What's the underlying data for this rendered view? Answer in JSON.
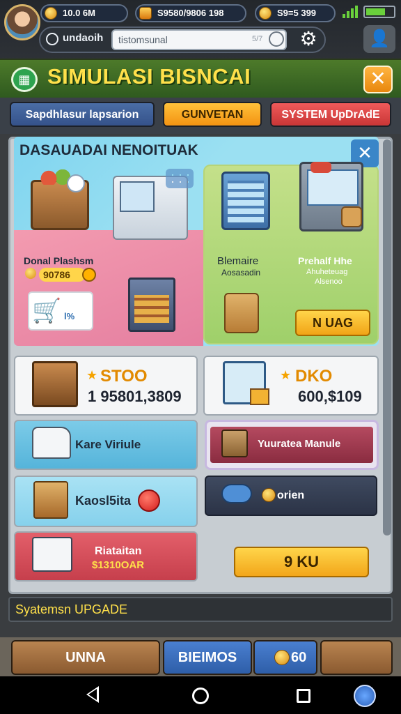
{
  "status_bar": {
    "resource1": "10.0 6M",
    "resource2": "S9580/9806 198",
    "resource3": "S9=5 399"
  },
  "browser": {
    "label": "undaoih",
    "input_value": "tistomsunal",
    "count": "5/7"
  },
  "header": {
    "title": "SIMULASI BISNCAI"
  },
  "tabs": [
    {
      "label": "Sapdhlasur lapsarion"
    },
    {
      "label": "GUNVETAN"
    },
    {
      "label": "SYSTEM UpDrAdE"
    }
  ],
  "featured": {
    "title": "DASAUADAI NENOITUAK",
    "promo_label": "Donal Plashsm",
    "promo_value": "90786",
    "cart_tag": "l%",
    "store1_name": "Blemaire",
    "store1_sub": "Aosasadin",
    "store2_name": "Prehalf Hhe",
    "store2_sub": "Ahuheteuag",
    "store2_sub2": "Alsenoo",
    "unlock_label": "N UAG"
  },
  "cards": {
    "stock1": {
      "title": "STOO",
      "value": "1 95801,3809"
    },
    "stock2": {
      "title": "DKO",
      "value": "600,$109"
    },
    "vehicle_label": "Kare Viriule",
    "warehouse_label": "Yuuratea Manule",
    "kaosita_label": "Kaosl5ita",
    "cloud_label": "orien",
    "register_title": "Riataitan",
    "register_value": "$1310OAR",
    "ok_label": "9 KU"
  },
  "status_strip": {
    "text": "Syatemsn UPGADE"
  },
  "bottom_nav": {
    "nav1": "UNNA",
    "nav2": "BIEIMOS",
    "nav3": "60"
  }
}
